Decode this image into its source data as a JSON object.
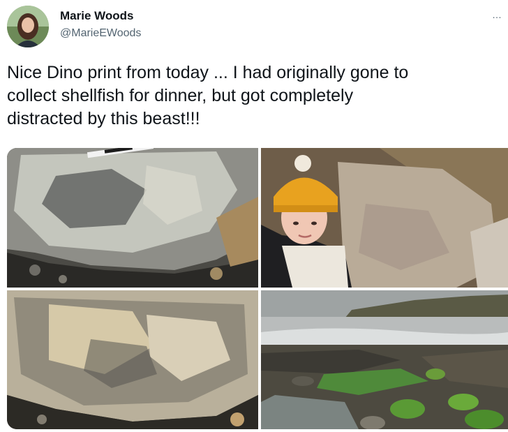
{
  "author": {
    "display_name": "Marie Woods",
    "handle": "@MarieEWoods"
  },
  "more_icon": "…",
  "tweet": {
    "text": "Nice Dino print from today ... I had originally gone to\ncollect shellfish for dinner, but got completely\ndistracted by this beast!!!"
  },
  "media": [
    {
      "subject": "dinosaur-footprint-rock-with-scale-bar"
    },
    {
      "subject": "selfie-yellow-beanie-by-rock"
    },
    {
      "subject": "dinosaur-footprint-rock-closeup"
    },
    {
      "subject": "rocky-shoreline-with-sea-and-cliffs"
    }
  ],
  "colors": {
    "text": "#0f1419",
    "secondary": "#536471",
    "beanie": "#e8a21f"
  }
}
